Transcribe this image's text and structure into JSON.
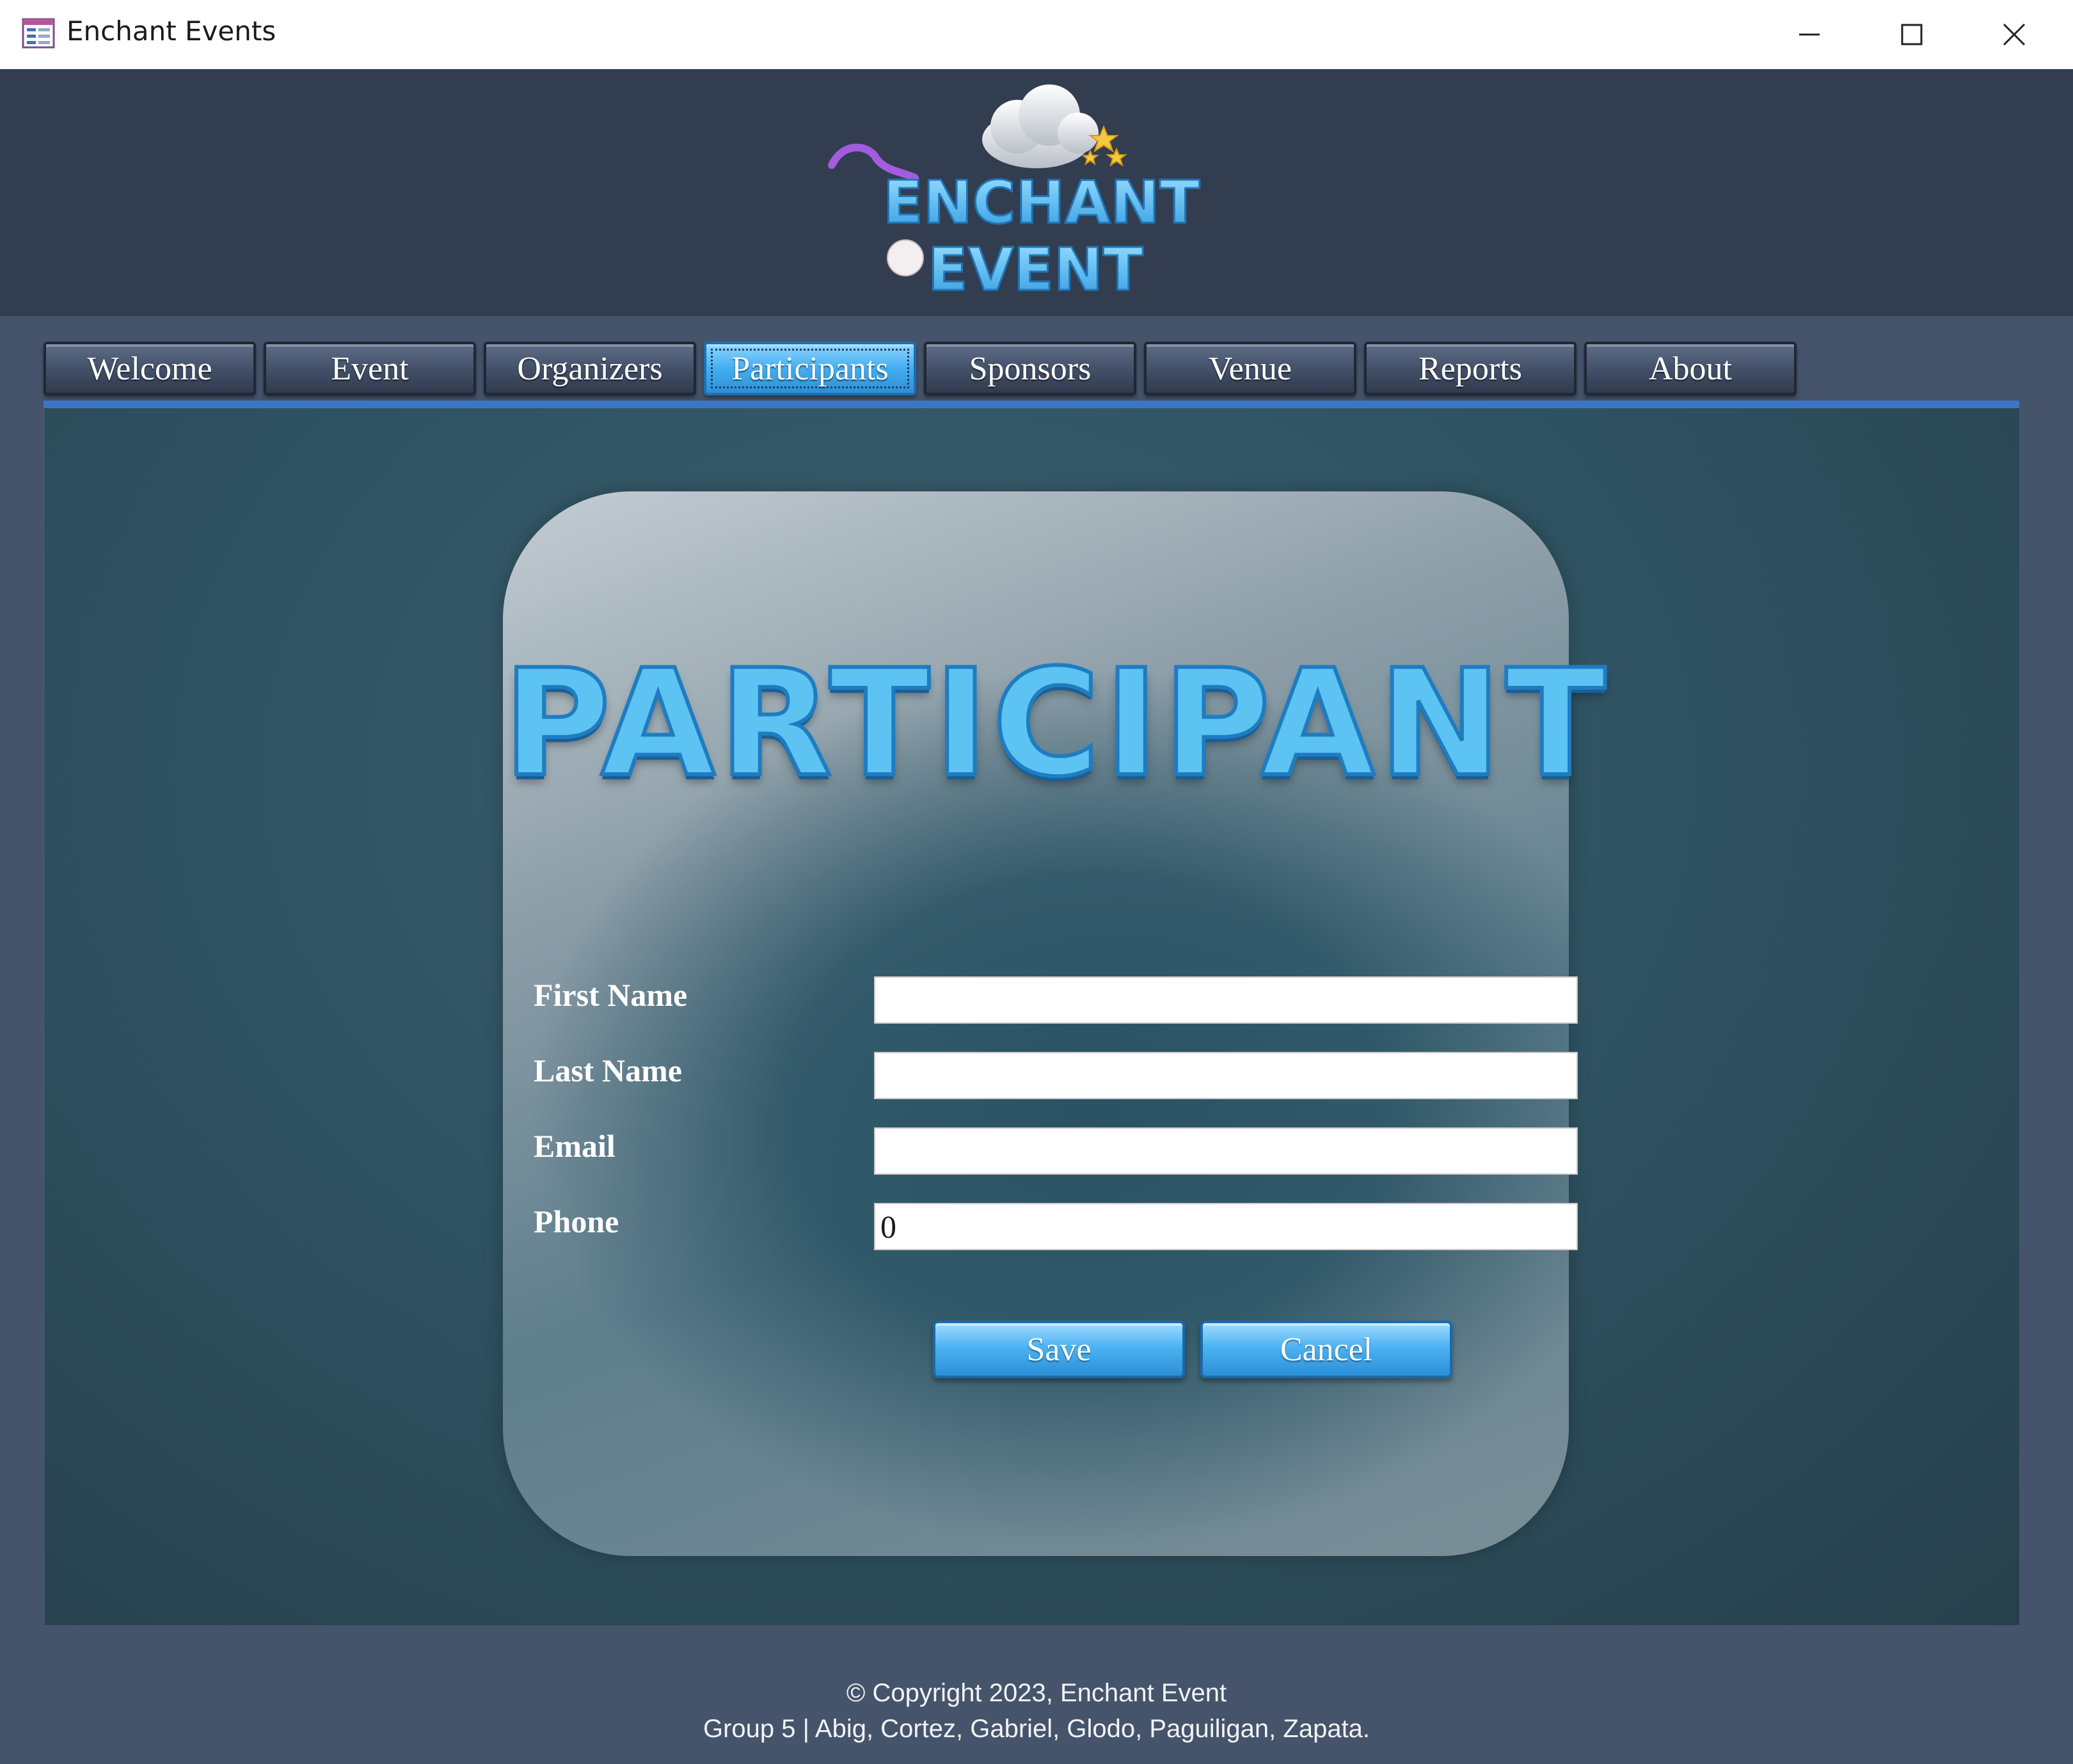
{
  "window": {
    "title": "Enchant Events"
  },
  "header": {
    "logo_line1": "ENCHANT",
    "logo_line2": "EVENT"
  },
  "tabs": [
    {
      "label": "Welcome",
      "active": false
    },
    {
      "label": "Event",
      "active": false
    },
    {
      "label": "Organizers",
      "active": false
    },
    {
      "label": "Participants",
      "active": true
    },
    {
      "label": "Sponsors",
      "active": false
    },
    {
      "label": "Venue",
      "active": false
    },
    {
      "label": "Reports",
      "active": false
    },
    {
      "label": "About",
      "active": false
    }
  ],
  "form": {
    "title": "PARTICIPANT",
    "fields": [
      {
        "label": "First Name",
        "value": ""
      },
      {
        "label": "Last Name",
        "value": ""
      },
      {
        "label": "Email",
        "value": ""
      },
      {
        "label": "Phone",
        "value": "0"
      }
    ],
    "save_label": "Save",
    "cancel_label": "Cancel"
  },
  "footer": {
    "copyright": "© Copyright 2023, Enchant Event",
    "credits": "Group 5 | Abig, Cortez, Gabriel, Glodo, Paguiligan, Zapata."
  },
  "colors": {
    "accent": "#3e74c7",
    "active_tab": "#43aef0",
    "header_bg": "#323d50",
    "body_bg": "#45546b"
  }
}
